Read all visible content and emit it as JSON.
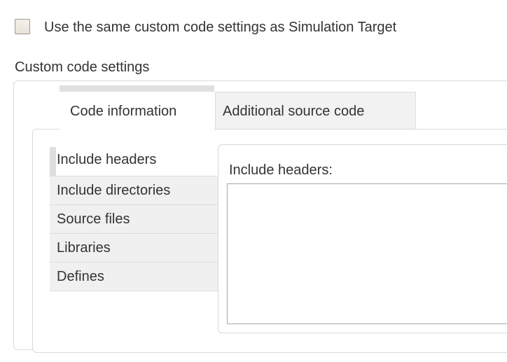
{
  "use_same_settings": {
    "label": "Use the same custom code settings as Simulation Target",
    "checked": false
  },
  "custom_code": {
    "section_title": "Custom code settings",
    "tabs": [
      {
        "label": "Code information",
        "active": true
      },
      {
        "label": "Additional source code",
        "active": false
      }
    ],
    "categories": [
      {
        "label": "Include headers",
        "selected": true
      },
      {
        "label": "Include directories",
        "selected": false
      },
      {
        "label": "Source files",
        "selected": false
      },
      {
        "label": "Libraries",
        "selected": false
      },
      {
        "label": "Defines",
        "selected": false
      }
    ],
    "detail": {
      "label": "Include headers:",
      "value": ""
    }
  },
  "colors": {
    "text": "#333333",
    "panel_border": "#d9d9d9",
    "list_background": "#f0f0f0",
    "inactive_tab_background": "#f2f2f2",
    "active_indicator": "#e0e0e0"
  }
}
